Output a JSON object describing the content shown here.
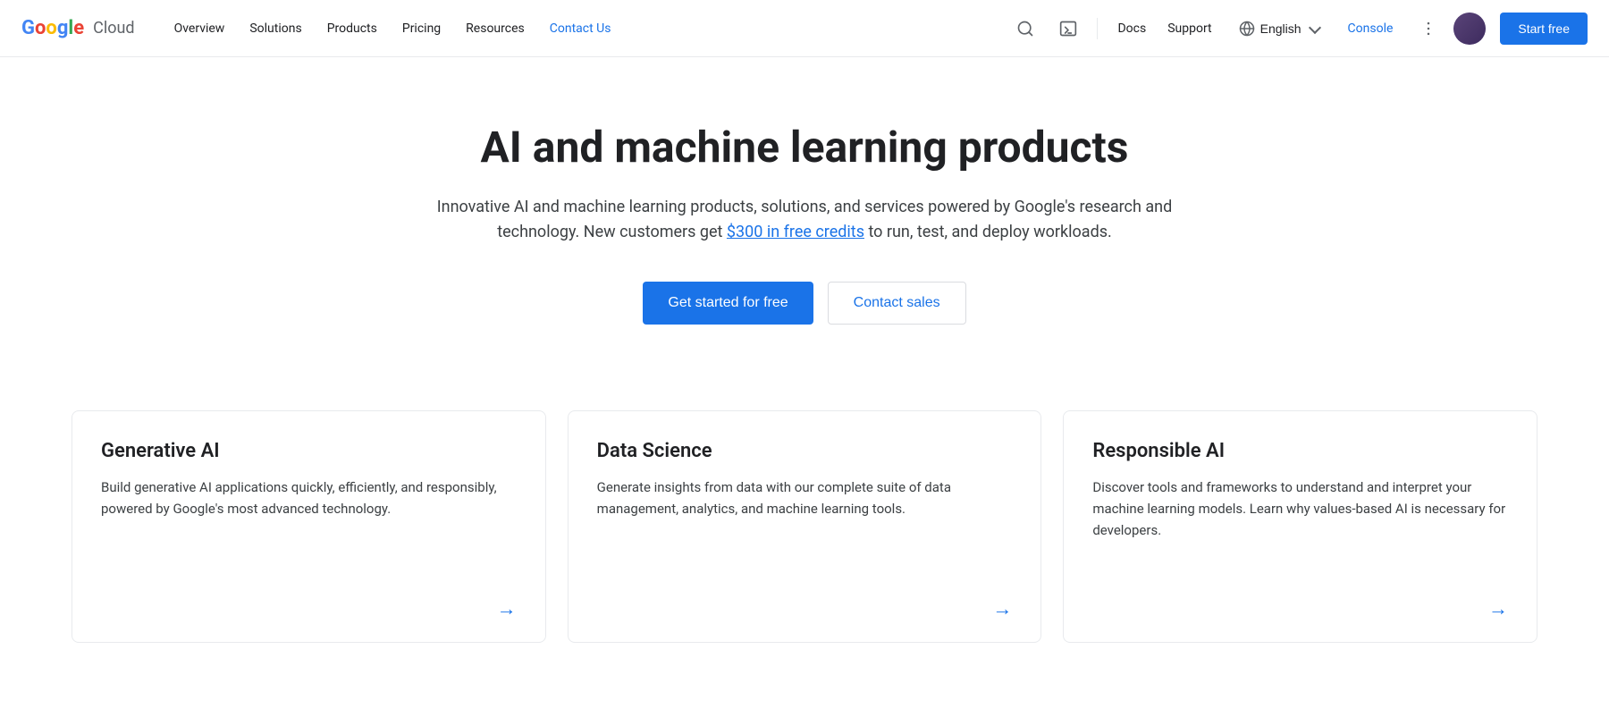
{
  "navbar": {
    "logo_google": "Google",
    "logo_cloud": "Cloud",
    "links": [
      {
        "label": "Overview",
        "id": "overview",
        "active": false
      },
      {
        "label": "Solutions",
        "id": "solutions",
        "active": false
      },
      {
        "label": "Products",
        "id": "products",
        "active": false
      },
      {
        "label": "Pricing",
        "id": "pricing",
        "active": false
      },
      {
        "label": "Resources",
        "id": "resources",
        "active": false
      },
      {
        "label": "Contact Us",
        "id": "contact-us",
        "active": true
      }
    ],
    "docs_label": "Docs",
    "support_label": "Support",
    "language_label": "English",
    "console_label": "Console",
    "start_free_label": "Start free"
  },
  "hero": {
    "title": "AI and machine learning products",
    "subtitle_before": "Innovative AI and machine learning products, solutions, and services powered by Google's research and technology. New customers get ",
    "subtitle_link": "$300 in free credits",
    "subtitle_after": " to run, test, and deploy workloads.",
    "btn_primary": "Get started for free",
    "btn_secondary": "Contact sales"
  },
  "cards": [
    {
      "id": "generative-ai",
      "title": "Generative AI",
      "description": "Build generative AI applications quickly, efficiently, and responsibly, powered by Google's most advanced technology.",
      "arrow": "→"
    },
    {
      "id": "data-science",
      "title": "Data Science",
      "description": "Generate insights from data with our complete suite of data management, analytics, and machine learning tools.",
      "arrow": "→"
    },
    {
      "id": "responsible-ai",
      "title": "Responsible AI",
      "description": "Discover tools and frameworks to understand and interpret your machine learning models. Learn why values-based AI is necessary for developers.",
      "arrow": "→"
    }
  ]
}
